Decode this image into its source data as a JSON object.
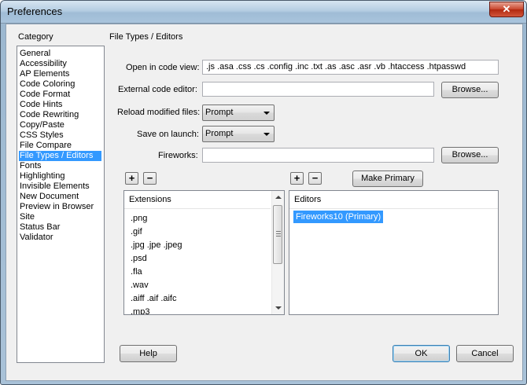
{
  "window": {
    "title": "Preferences",
    "close_label": "✕"
  },
  "category": {
    "heading": "Category",
    "items": [
      "General",
      "Accessibility",
      "AP Elements",
      "Code Coloring",
      "Code Format",
      "Code Hints",
      "Code Rewriting",
      "Copy/Paste",
      "CSS Styles",
      "File Compare",
      "File Types / Editors",
      "Fonts",
      "Highlighting",
      "Invisible Elements",
      "New Document",
      "Preview in Browser",
      "Site",
      "Status Bar",
      "Validator"
    ],
    "selected": "File Types / Editors"
  },
  "section_title": "File Types / Editors",
  "form": {
    "open_in_code_view_label": "Open in code view:",
    "open_in_code_view_value": ".js .asa .css .cs .config .inc .txt .as .asc .asr .vb .htaccess .htpasswd",
    "external_editor_label": "External code editor:",
    "external_editor_value": "",
    "browse_label": "Browse...",
    "reload_label": "Reload modified files:",
    "reload_value": "Prompt",
    "save_label": "Save on launch:",
    "save_value": "Prompt",
    "fireworks_label": "Fireworks:",
    "fireworks_value": ""
  },
  "buttons": {
    "plus": "+",
    "minus": "−",
    "make_primary": "Make Primary",
    "help": "Help",
    "ok": "OK",
    "cancel": "Cancel"
  },
  "extensions": {
    "header": "Extensions",
    "items": [
      ".png",
      ".gif",
      ".jpg .jpe .jpeg",
      ".psd",
      ".fla",
      ".wav",
      ".aiff .aif .aifc",
      ".mp3"
    ]
  },
  "editors": {
    "header": "Editors",
    "items": [
      "Fireworks10 (Primary)"
    ]
  }
}
